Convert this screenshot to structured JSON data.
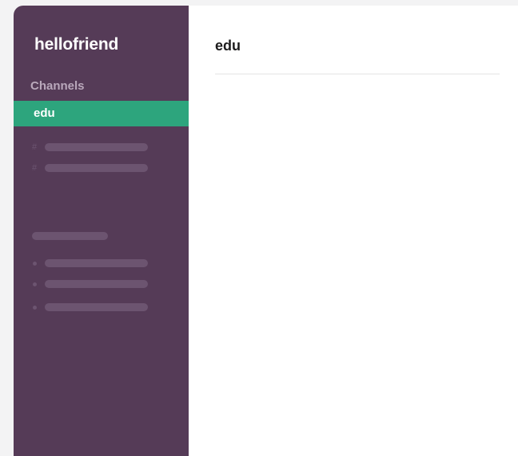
{
  "workspace": {
    "name": "hellofriend"
  },
  "sidebar": {
    "section_title": "Channels",
    "active_channel": "edu",
    "channel_prefix": "#"
  },
  "main": {
    "title": "edu"
  },
  "colors": {
    "sidebar_bg": "#553b57",
    "active_channel_bg": "#2da57d",
    "placeholder": "#6c5470",
    "section_title": "#b9a8bb"
  }
}
